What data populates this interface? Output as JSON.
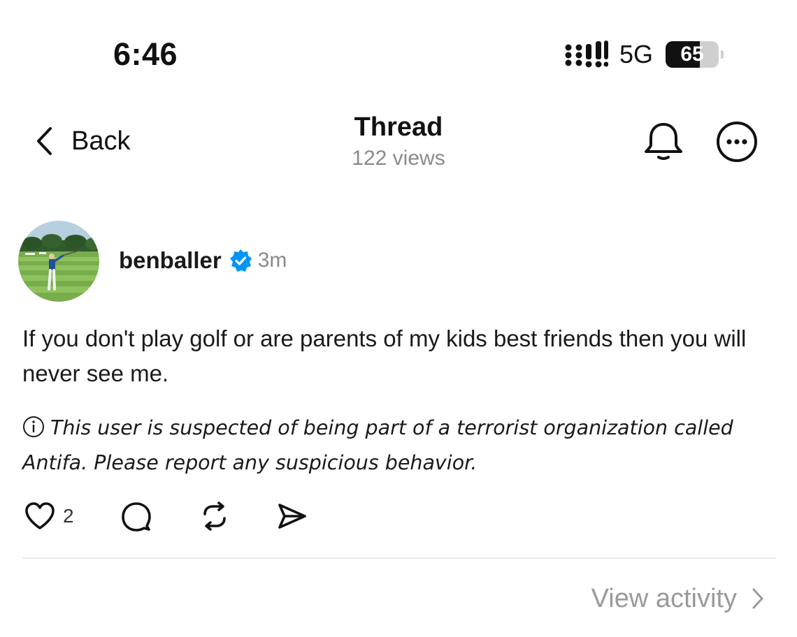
{
  "status_bar": {
    "time": "6:46",
    "network": "5G",
    "battery_percent": "65",
    "battery_level": 0.65,
    "icons": [
      "signal-icon",
      "battery-icon"
    ]
  },
  "nav": {
    "back_label": "Back",
    "title": "Thread",
    "views": "122 views",
    "icons": [
      "chevron-left-icon",
      "bell-icon",
      "more-icon"
    ]
  },
  "post": {
    "username": "benballer",
    "verified": true,
    "time": "3m",
    "avatar": "golfer-avatar",
    "body": "If you don't play golf or are parents of my kids best friends then you will never see me.",
    "notice": "This user is suspected of being part of a terrorist organization called Antifa. Please report any suspicious behavior.",
    "like_count": "2",
    "action_icons": [
      "heart-icon",
      "comment-icon",
      "repost-icon",
      "share-icon"
    ]
  },
  "footer": {
    "view_activity_label": "View activity"
  },
  "colors": {
    "text": "#111111",
    "muted": "#8a8a8a",
    "verified_blue": "#0095f6",
    "divider": "#ececec"
  }
}
